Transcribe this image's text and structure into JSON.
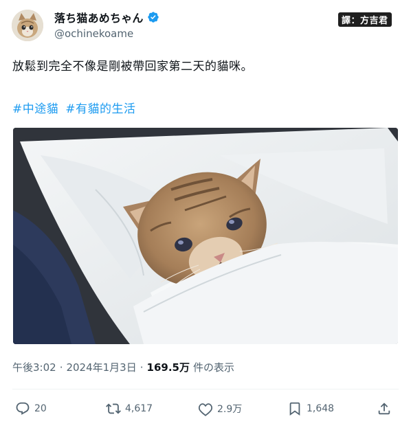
{
  "author": {
    "display_name": "落ち猫あめちゃん",
    "handle": "@ochinekoame",
    "verified": true
  },
  "translator_badge": "譯：方吉君",
  "post": {
    "text": "放鬆到完全不像是剛被帶回家第二天的貓咪。",
    "hashtags": [
      "#中途貓",
      "#有貓的生活"
    ]
  },
  "meta": {
    "time": "午後3:02",
    "separator": "·",
    "date": "2024年1月3日",
    "views_count": "169.5万",
    "views_label": "件の表示"
  },
  "actions": {
    "replies": "20",
    "reposts": "4,617",
    "likes": "2.9万",
    "bookmarks": "1,648"
  },
  "colors": {
    "link": "#1d9bf0",
    "verified": "#1d9bf0",
    "secondary_text": "#536471",
    "primary_text": "#0f1419"
  },
  "icons": {
    "reply": "reply-icon",
    "repost": "repost-icon",
    "like": "heart-icon",
    "bookmark": "bookmark-icon",
    "share": "share-icon",
    "verified": "verified-badge-icon"
  }
}
